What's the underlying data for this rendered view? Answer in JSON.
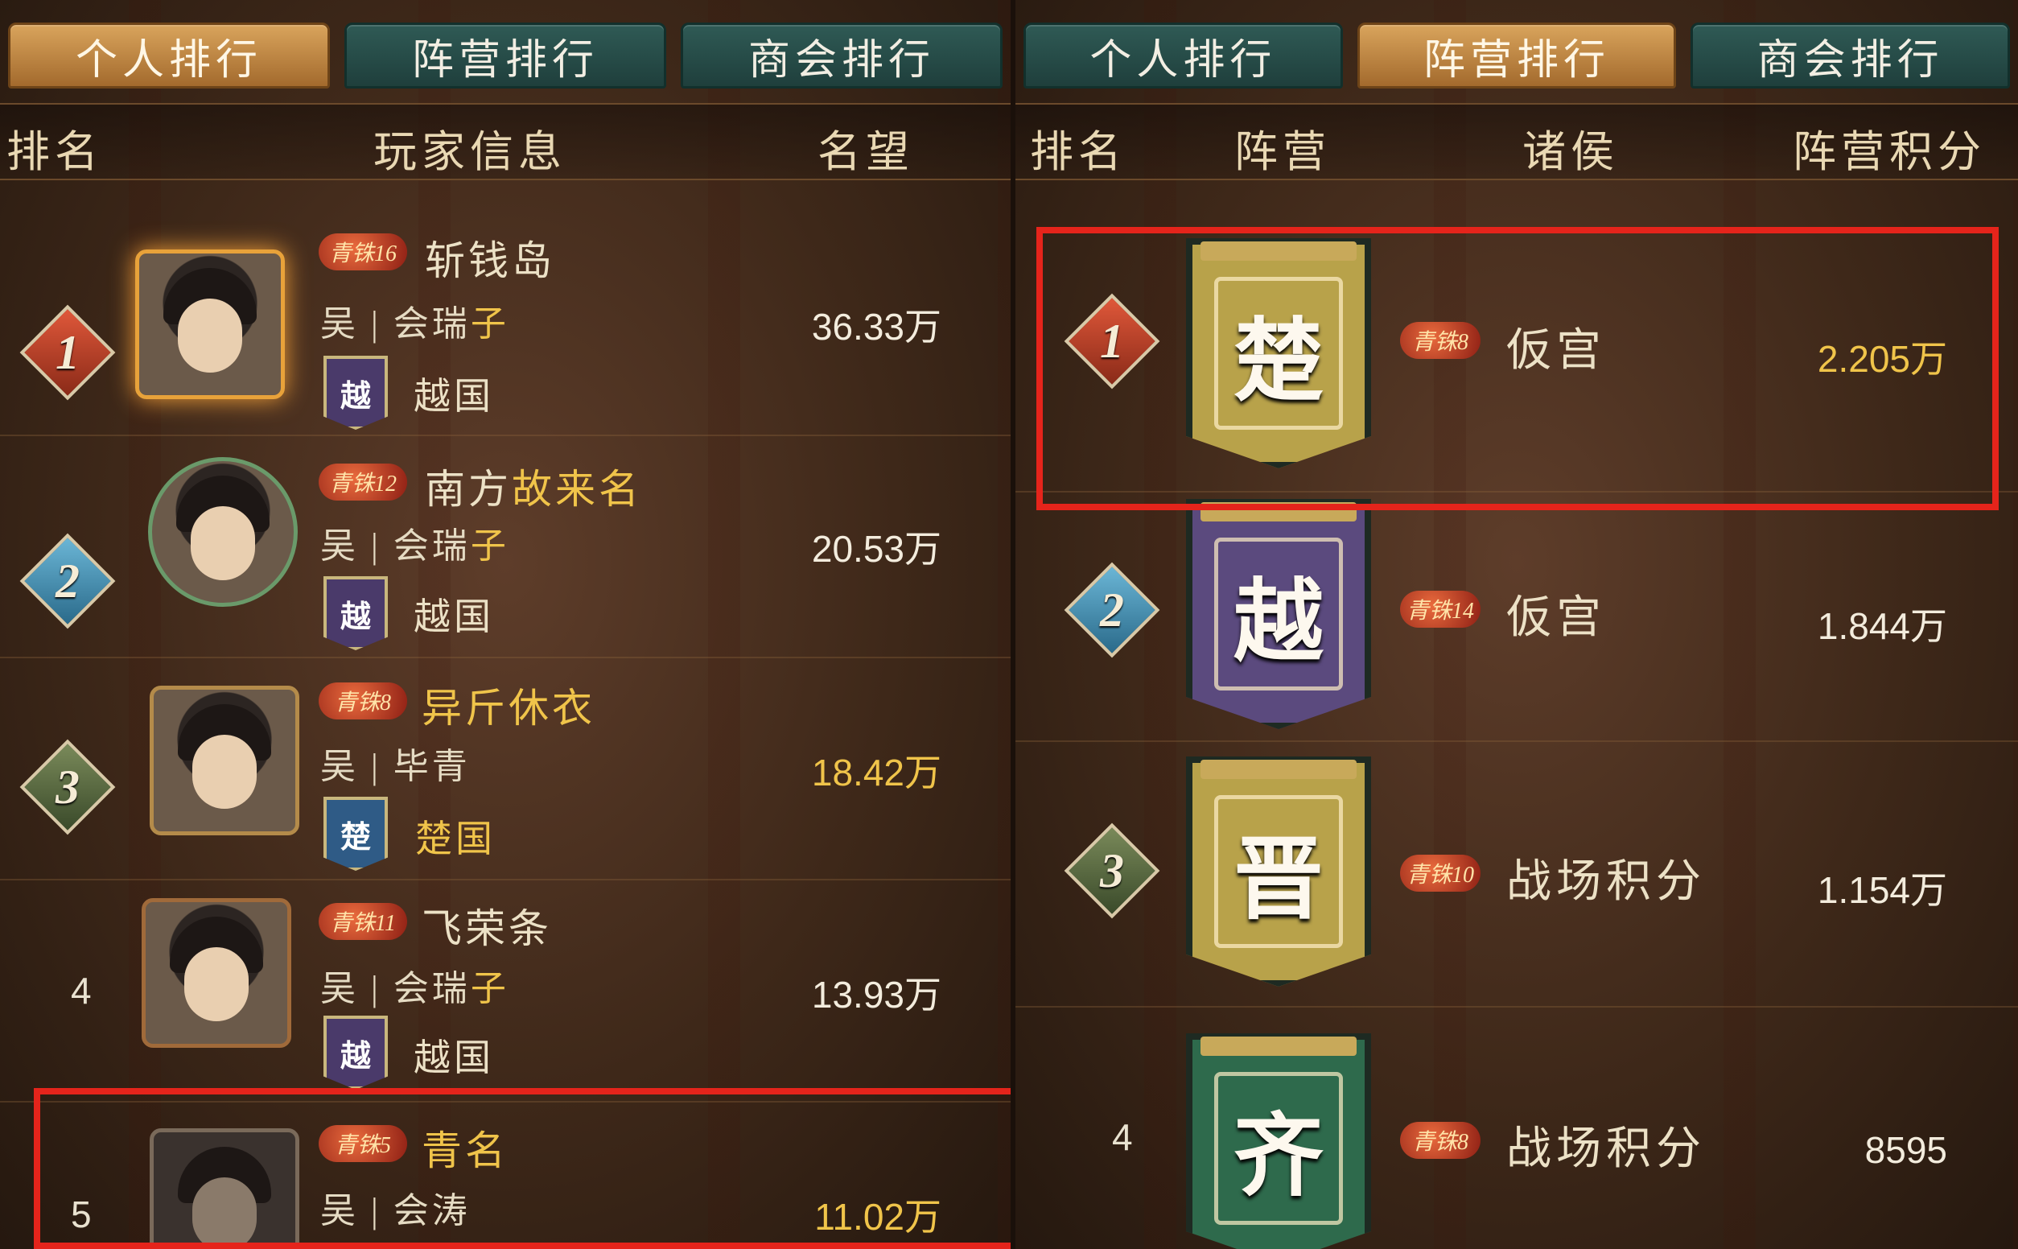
{
  "left_panel": {
    "tabs": [
      {
        "label": "个人排行",
        "active": true
      },
      {
        "label": "阵营排行",
        "active": false
      },
      {
        "label": "商会排行",
        "active": false
      }
    ],
    "header": {
      "rank": "排名",
      "player": "玩家信息",
      "score": "名望"
    },
    "rows": [
      {
        "rank": "1",
        "tier": "青铢16",
        "name": "斩钱岛",
        "server": "吴 | 会瑞",
        "server_suffix": "子",
        "kingdom_badge": "越",
        "kingdom": "越国",
        "value": "36.33万"
      },
      {
        "rank": "2",
        "tier": "青铢12",
        "name": "南方",
        "name_gold": "故来名",
        "server": "吴 | 会瑞",
        "server_suffix": "子",
        "kingdom_badge": "越",
        "kingdom": "越国",
        "value": "20.53万"
      },
      {
        "rank": "3",
        "tier": "青铢8",
        "name_gold": "异斤休衣",
        "server": "吴 | 毕青",
        "kingdom_badge": "楚",
        "kingdom": "楚国",
        "value": "18.42万"
      },
      {
        "rank": "4",
        "tier": "青铢11",
        "name": "飞荣条",
        "server": "吴 | 会瑞",
        "server_suffix": "子",
        "kingdom_badge": "越",
        "kingdom": "越国",
        "value": "13.93万"
      },
      {
        "rank": "5",
        "tier": "青铢5",
        "name_gold": "青名",
        "server": "吴 | 会涛",
        "value": "11.02万"
      }
    ]
  },
  "right_panel": {
    "tabs": [
      {
        "label": "个人排行",
        "active": false
      },
      {
        "label": "阵营排行",
        "active": true
      },
      {
        "label": "商会排行",
        "active": false
      }
    ],
    "header": {
      "rank": "排名",
      "camp": "阵营",
      "lord": "诸侯",
      "score": "阵营积分"
    },
    "rows": [
      {
        "rank": "1",
        "banner": "楚",
        "banner_color": "#b8a24a",
        "tier": "青铢8",
        "lord": "仮宫",
        "value": "2.205万"
      },
      {
        "rank": "2",
        "banner": "越",
        "banner_color": "#5b4a7e",
        "tier": "青铢14",
        "lord": "仮宫",
        "value": "1.844万"
      },
      {
        "rank": "3",
        "banner": "晋",
        "banner_color": "#b8a24a",
        "tier": "青铢10",
        "lord": "战场积分",
        "value": "1.154万"
      },
      {
        "rank": "4",
        "banner": "齐",
        "banner_color": "#2e6a4c",
        "tier": "青铢8",
        "lord": "战场积分",
        "value": "8595"
      }
    ]
  },
  "colors": {
    "highlight": "#e5241b",
    "gold_text": "#f0c44a",
    "tab_active": "#c48a45",
    "tab_inactive": "#264c48"
  }
}
